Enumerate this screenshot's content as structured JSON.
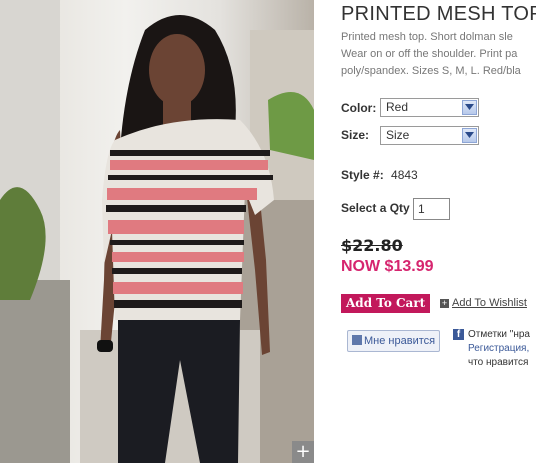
{
  "product": {
    "title": "PRINTED MESH TOP",
    "description_lines": [
      "Printed mesh top. Short dolman sle",
      "Wear on or off the shoulder. Print pa",
      "poly/spandex. Sizes S, M, L. Red/bla"
    ]
  },
  "options": {
    "color_label": "Color:",
    "color_value": "Red",
    "size_label": "Size:",
    "size_value": "Size",
    "style_label": "Style #:",
    "style_value": "4843",
    "qty_label": "Select a Qty",
    "qty_value": "1"
  },
  "price": {
    "old": "$22.80",
    "now": "NOW $13.99",
    "now_color": "#d6256f"
  },
  "actions": {
    "add_to_cart": "Add To Cart",
    "add_to_wishlist": "Add To Wishlist",
    "zoom_icon": "+"
  },
  "social": {
    "like_button": "Мне нравится",
    "fb_line1": "Отметки \"нра",
    "fb_line2": "Регистрация,",
    "fb_line3": "что нравится",
    "fb_icon": "f"
  },
  "colors": {
    "accent_button": "#c2185b",
    "facebook_blue": "#3b5998"
  }
}
